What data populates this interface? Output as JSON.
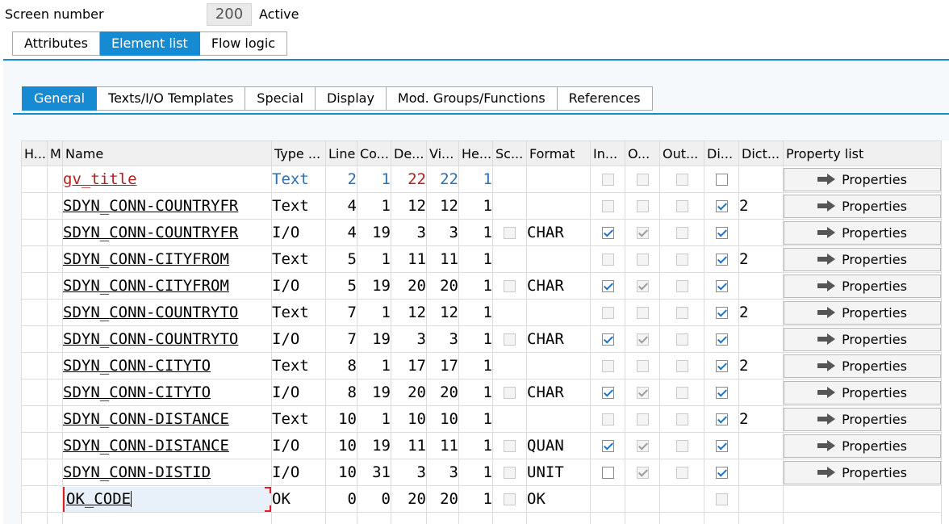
{
  "header": {
    "screen_label": "Screen number",
    "screen_number": "200",
    "status": "Active"
  },
  "outer_tabs": [
    {
      "label": "Attributes",
      "active": false
    },
    {
      "label": "Element list",
      "active": true
    },
    {
      "label": "Flow logic",
      "active": false
    }
  ],
  "inner_tabs": [
    {
      "label": "General",
      "active": true
    },
    {
      "label": "Texts/I/O Templates",
      "active": false
    },
    {
      "label": "Special",
      "active": false
    },
    {
      "label": "Display",
      "active": false
    },
    {
      "label": "Mod. Groups/Functions",
      "active": false
    },
    {
      "label": "References",
      "active": false
    }
  ],
  "columns": [
    "H...",
    "M",
    "Name",
    "Type ...",
    "Line",
    "Co...",
    "De...",
    "Vi...",
    "He...",
    "Sc...",
    "Format",
    "In...",
    "O...",
    "Out...",
    "Di...",
    "Dict...",
    "Property list"
  ],
  "property_button_label": "Properties",
  "colors": {
    "accent": "#168bd2",
    "red_text": "#b21f1f",
    "blue_text": "#2a6fb0"
  },
  "rows": [
    {
      "name": "gv_title",
      "type": "Text",
      "line": "2",
      "col": "1",
      "def": "22",
      "vis": "22",
      "height": "1",
      "scroll": null,
      "format": "",
      "input": false,
      "output": false,
      "out_only": false,
      "dict": false,
      "dict_ref": "",
      "prop": true,
      "style": "title"
    },
    {
      "name": "SDYN_CONN-COUNTRYFR",
      "type": "Text",
      "line": "4",
      "col": "1",
      "def": "12",
      "vis": "12",
      "height": "1",
      "scroll": null,
      "format": "",
      "input": false,
      "output": false,
      "out_only": false,
      "dict": true,
      "dict_ref": "2",
      "prop": true
    },
    {
      "name": "SDYN_CONN-COUNTRYFR",
      "type": "I/O",
      "line": "4",
      "col": "19",
      "def": "3",
      "vis": "3",
      "height": "1",
      "scroll": false,
      "format": "CHAR",
      "input": true,
      "output": true,
      "out_only": false,
      "dict": true,
      "dict_ref": "",
      "prop": true
    },
    {
      "name": "SDYN_CONN-CITYFROM",
      "type": "Text",
      "line": "5",
      "col": "1",
      "def": "11",
      "vis": "11",
      "height": "1",
      "scroll": null,
      "format": "",
      "input": false,
      "output": false,
      "out_only": false,
      "dict": true,
      "dict_ref": "2",
      "prop": true
    },
    {
      "name": "SDYN_CONN-CITYFROM",
      "type": "I/O",
      "line": "5",
      "col": "19",
      "def": "20",
      "vis": "20",
      "height": "1",
      "scroll": false,
      "format": "CHAR",
      "input": true,
      "output": true,
      "out_only": false,
      "dict": true,
      "dict_ref": "",
      "prop": true
    },
    {
      "name": "SDYN_CONN-COUNTRYTO",
      "type": "Text",
      "line": "7",
      "col": "1",
      "def": "12",
      "vis": "12",
      "height": "1",
      "scroll": null,
      "format": "",
      "input": false,
      "output": false,
      "out_only": false,
      "dict": true,
      "dict_ref": "2",
      "prop": true
    },
    {
      "name": "SDYN_CONN-COUNTRYTO",
      "type": "I/O",
      "line": "7",
      "col": "19",
      "def": "3",
      "vis": "3",
      "height": "1",
      "scroll": false,
      "format": "CHAR",
      "input": true,
      "output": true,
      "out_only": false,
      "dict": true,
      "dict_ref": "",
      "prop": true
    },
    {
      "name": "SDYN_CONN-CITYTO",
      "type": "Text",
      "line": "8",
      "col": "1",
      "def": "17",
      "vis": "17",
      "height": "1",
      "scroll": null,
      "format": "",
      "input": false,
      "output": false,
      "out_only": false,
      "dict": true,
      "dict_ref": "2",
      "prop": true
    },
    {
      "name": "SDYN_CONN-CITYTO",
      "type": "I/O",
      "line": "8",
      "col": "19",
      "def": "20",
      "vis": "20",
      "height": "1",
      "scroll": false,
      "format": "CHAR",
      "input": true,
      "output": true,
      "out_only": false,
      "dict": true,
      "dict_ref": "",
      "prop": true
    },
    {
      "name": "SDYN_CONN-DISTANCE",
      "type": "Text",
      "line": "10",
      "col": "1",
      "def": "10",
      "vis": "10",
      "height": "1",
      "scroll": null,
      "format": "",
      "input": false,
      "output": false,
      "out_only": false,
      "dict": true,
      "dict_ref": "2",
      "prop": true
    },
    {
      "name": "SDYN_CONN-DISTANCE",
      "type": "I/O",
      "line": "10",
      "col": "19",
      "def": "11",
      "vis": "11",
      "height": "1",
      "scroll": false,
      "format": "QUAN",
      "input": true,
      "output": true,
      "out_only": false,
      "dict": true,
      "dict_ref": "",
      "prop": true
    },
    {
      "name": "SDYN_CONN-DISTID",
      "type": "I/O",
      "line": "10",
      "col": "31",
      "def": "3",
      "vis": "3",
      "height": "1",
      "scroll": false,
      "format": "UNIT",
      "input": false,
      "output": true,
      "out_only": false,
      "dict": true,
      "dict_ref": "",
      "prop": true,
      "input_enabled": true
    },
    {
      "name": "OK_CODE",
      "type": "OK",
      "line": "0",
      "col": "0",
      "def": "20",
      "vis": "20",
      "height": "1",
      "scroll": false,
      "format": "OK",
      "input": null,
      "output": null,
      "out_only": null,
      "dict": false,
      "dict_ref": "",
      "prop": false,
      "style": "okcode"
    }
  ]
}
